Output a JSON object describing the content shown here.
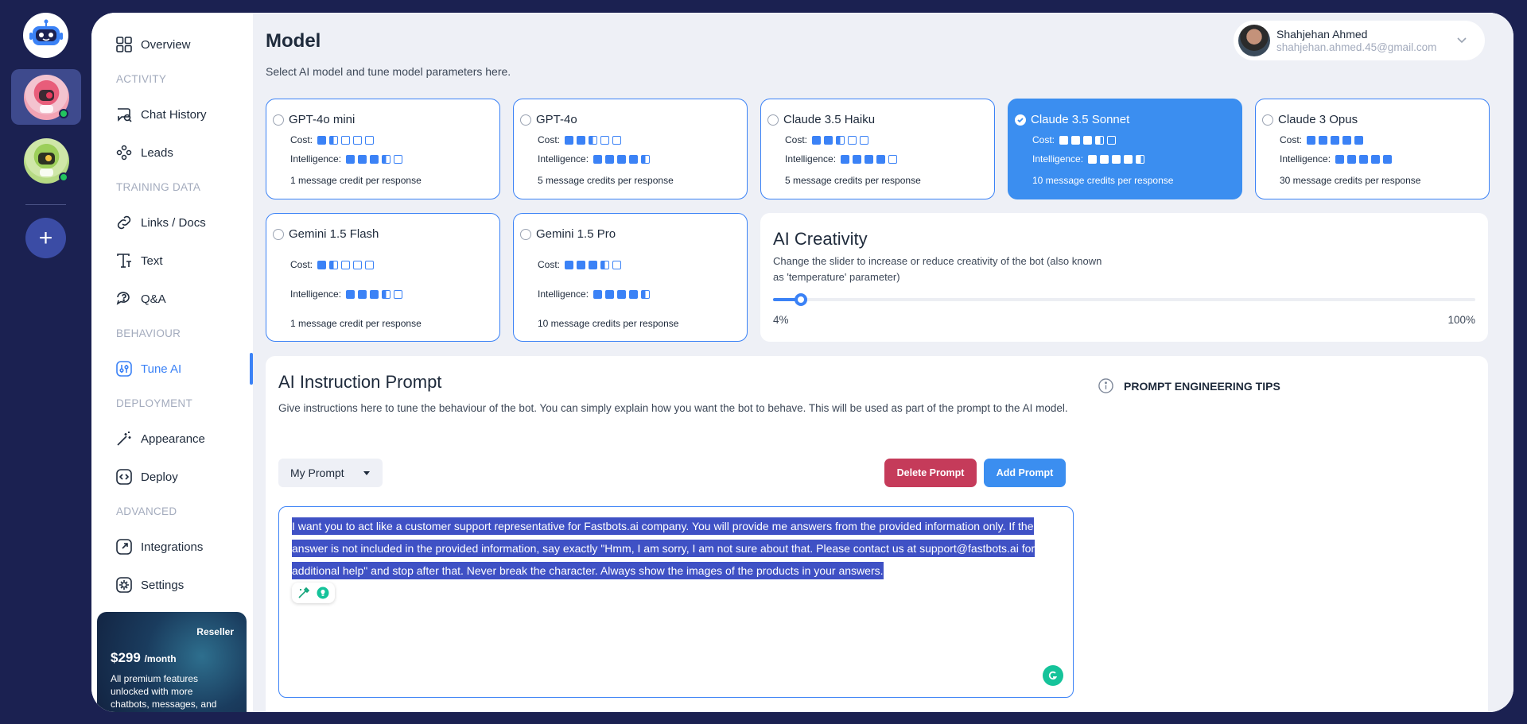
{
  "bots": [
    {
      "name": "bot-1",
      "active": true,
      "online": true
    },
    {
      "name": "bot-2",
      "active": false,
      "online": true
    }
  ],
  "sidebar": {
    "items": [
      {
        "label": "Overview",
        "icon": "grid-icon"
      },
      {
        "label": "Chat History",
        "icon": "chat-history-icon"
      },
      {
        "label": "Leads",
        "icon": "leads-icon"
      },
      {
        "label": "Links / Docs",
        "icon": "link-icon"
      },
      {
        "label": "Text",
        "icon": "text-icon"
      },
      {
        "label": "Q&A",
        "icon": "qa-icon"
      },
      {
        "label": "Tune AI",
        "icon": "tune-icon"
      },
      {
        "label": "Appearance",
        "icon": "magic-wand-icon"
      },
      {
        "label": "Deploy",
        "icon": "code-icon"
      },
      {
        "label": "Integrations",
        "icon": "integrations-icon"
      },
      {
        "label": "Settings",
        "icon": "gear-icon"
      }
    ],
    "sections": [
      "ACTIVITY",
      "TRAINING DATA",
      "BEHAVIOUR",
      "DEPLOYMENT",
      "ADVANCED"
    ],
    "active_item": "Tune AI"
  },
  "promo": {
    "tag": "Reseller",
    "price": "$299",
    "period": "/month",
    "description": "All premium features unlocked with more chatbots, messages, and"
  },
  "header": {
    "title": "Model",
    "subtitle": "Select AI model and tune model parameters here."
  },
  "user": {
    "name": "Shahjehan Ahmed",
    "email": "shahjehan.ahmed.45@gmail.com"
  },
  "models": [
    {
      "name": "GPT-4o mini",
      "cost": 1.5,
      "intelligence": 3.5,
      "credits": "1 message credit per response",
      "selected": false
    },
    {
      "name": "GPT-4o",
      "cost": 2.5,
      "intelligence": 4.5,
      "credits": "5 message credits per response",
      "selected": false
    },
    {
      "name": "Claude 3.5 Haiku",
      "cost": 2.5,
      "intelligence": 4,
      "credits": "5 message credits per response",
      "selected": false
    },
    {
      "name": "Claude 3.5 Sonnet",
      "cost": 3.5,
      "intelligence": 4.5,
      "credits": "10 message credits per response",
      "selected": true
    },
    {
      "name": "Claude 3 Opus",
      "cost": 5,
      "intelligence": 5,
      "credits": "30 message credits per response",
      "selected": false
    },
    {
      "name": "Gemini 1.5 Flash",
      "cost": 1.5,
      "intelligence": 3.5,
      "credits": "1 message credit per response",
      "selected": false
    },
    {
      "name": "Gemini 1.5 Pro",
      "cost": 3.5,
      "intelligence": 4.5,
      "credits": "10 message credits per response",
      "selected": false
    }
  ],
  "labels": {
    "cost": "Cost:",
    "intelligence": "Intelligence:"
  },
  "creativity": {
    "title": "AI Creativity",
    "description": "Change the slider to increase or reduce creativity of the bot (also known as 'temperature' parameter)",
    "value_percent": 4,
    "min_label": "4%",
    "max_label": "100%"
  },
  "prompt": {
    "title": "AI Instruction Prompt",
    "description": "Give instructions here to tune the behaviour of the bot. You can simply explain how you want the bot to behave. This will be used as part of the prompt to the AI model.",
    "selected_prompt": "My Prompt",
    "delete_label": "Delete Prompt",
    "add_label": "Add Prompt",
    "text": "I want you to act like a customer support representative for Fastbots.ai company. You will provide me answers from the provided information only. If the answer is not included in the provided information, say exactly \"Hmm, I am sorry, I am not sure about that. Please contact us at support@fastbots.ai for additional help\" and stop after that. Never break the character. Always show the images of the products in your answers.",
    "tips_label": "PROMPT ENGINEERING TIPS"
  },
  "colors": {
    "accent": "#3b82f6",
    "selected_card": "#3b8ef0",
    "delete": "#c53b5a",
    "rail_bg": "#1b2151",
    "content_bg": "#eef0f6"
  }
}
